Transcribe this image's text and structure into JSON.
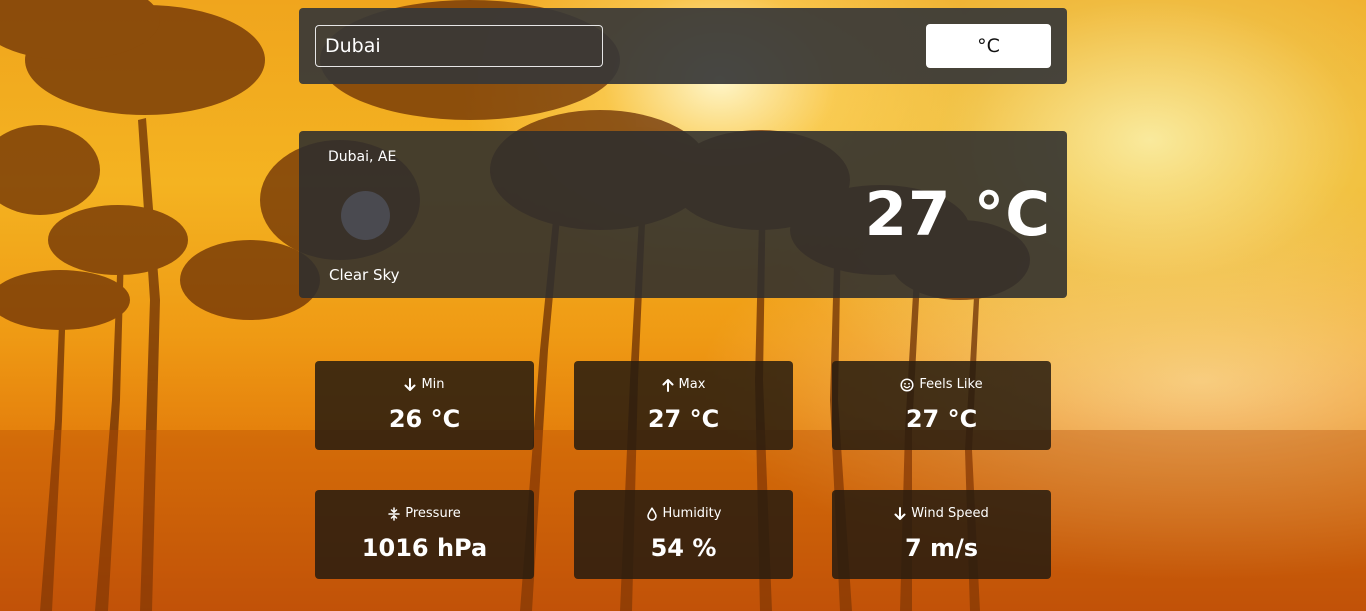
{
  "search": {
    "value": "Dubai"
  },
  "unit_toggle": {
    "label": "°C"
  },
  "current": {
    "location": "Dubai, AE",
    "condition": "Clear Sky",
    "temperature": "27 °C",
    "icon": "weather-icon"
  },
  "stats": [
    {
      "label": "Min",
      "value": "26 °C",
      "icon": "arrow-down-icon"
    },
    {
      "label": "Max",
      "value": "27 °C",
      "icon": "arrow-up-icon"
    },
    {
      "label": "Feels Like",
      "value": "27 °C",
      "icon": "smile-icon"
    },
    {
      "label": "Pressure",
      "value": "1016 hPa",
      "icon": "pressure-icon"
    },
    {
      "label": "Humidity",
      "value": "54 %",
      "icon": "droplet-icon"
    },
    {
      "label": "Wind Speed",
      "value": "7 m/s",
      "icon": "arrow-down-icon"
    }
  ],
  "colors": {
    "panel": "#373737",
    "stat_panel": "#281c0f",
    "background_warm": "#f0a51d"
  }
}
